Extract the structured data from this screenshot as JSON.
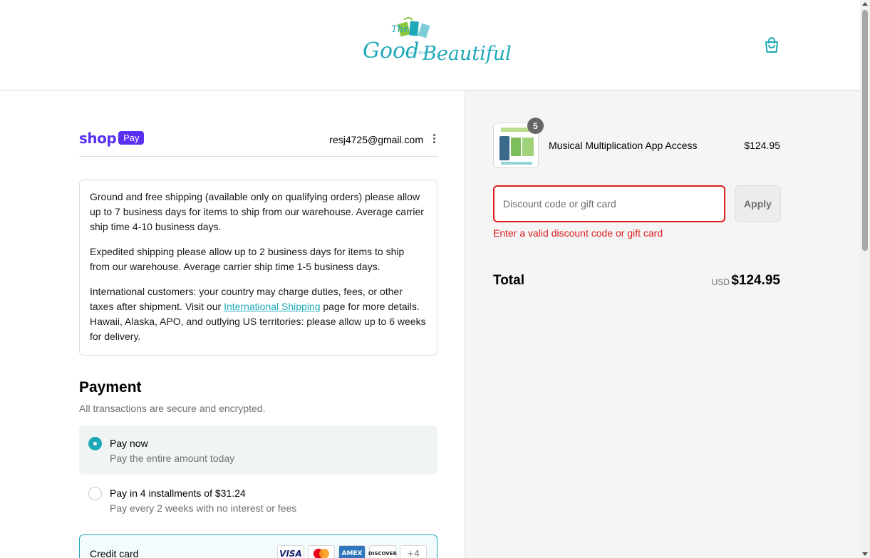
{
  "header": {
    "logo_word_the": "The",
    "logo_word_good": "Good",
    "logo_word_and_the": "AND THE",
    "logo_word_beautiful": "Beautiful",
    "cart_icon": "shopping-bag-icon"
  },
  "account": {
    "shop_label": "shop",
    "pay_label": "Pay",
    "email": "resj4725@gmail.com"
  },
  "notice": {
    "paragraph_1": "Ground and free shipping (available only on qualifying orders) please allow up to 7 business days for items to ship from our warehouse. Average carrier ship time 4-10 business days.",
    "paragraph_2": "Expedited shipping please allow up to 2 business days for items to ship from our warehouse. Average carrier ship time 1-5 business days.",
    "paragraph_3_before_link": "International customers: your country may charge duties, fees, or other taxes after shipment. Visit our ",
    "paragraph_3_link": "International Shipping",
    "paragraph_3_after_link": " page for more details. Hawaii, Alaska, APO, and outlying US territories: please allow up to 6 weeks for delivery."
  },
  "payment": {
    "title": "Payment",
    "subtitle": "All transactions are secure and encrypted.",
    "options": [
      {
        "label": "Pay now",
        "sublabel": "Pay the entire amount today",
        "selected": true
      },
      {
        "label": "Pay in 4 installments of $31.24",
        "sublabel": "Pay every 2 weeks with no interest or fees",
        "selected": false
      }
    ],
    "credit_card_label": "Credit card",
    "card_brands": [
      "VISA",
      "mastercard",
      "AMEX",
      "DISCOVER",
      "+4"
    ]
  },
  "summary": {
    "product": {
      "name": "Musical Multiplication App Access",
      "quantity": "5",
      "price": "$124.95"
    },
    "discount": {
      "placeholder": "Discount code or gift card",
      "value": "",
      "apply_label": "Apply",
      "error": "Enter a valid discount code or gift card"
    },
    "total_label": "Total",
    "currency": "USD",
    "total_amount": "$124.95"
  },
  "colors": {
    "accent": "#1fa9b8",
    "shop_purple": "#5a31f4",
    "error": "#dd1d1d"
  }
}
